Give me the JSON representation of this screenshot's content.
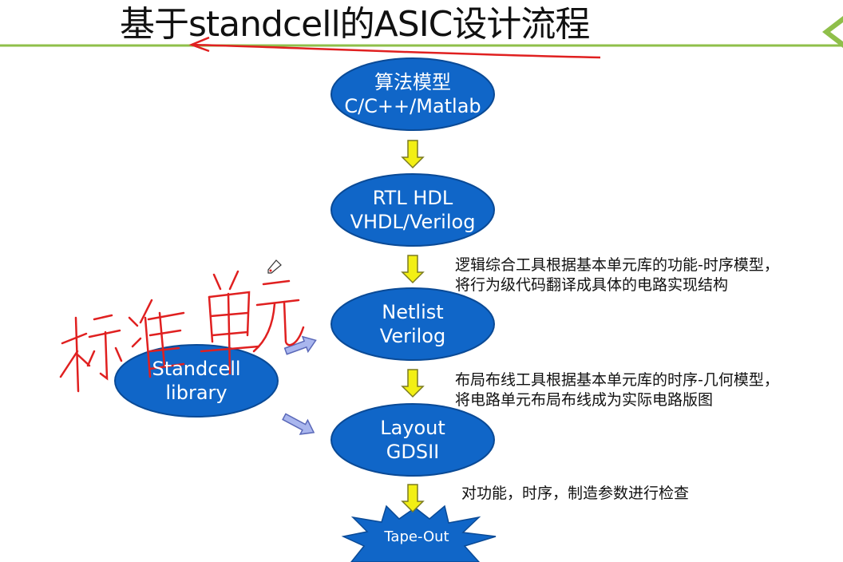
{
  "title": "基于standcell的ASIC设计流程",
  "colors": {
    "node_fill": "#1066c8",
    "node_stroke": "#0a4a96",
    "arrow_fill": "#f2ef14",
    "arrow_stroke": "#7a7a20",
    "side_arrow_fill": "#a9b6ee",
    "side_arrow_stroke": "#5a68b8",
    "header_line": "#8fbf4a",
    "annotation_red": "#e02020"
  },
  "flow": [
    {
      "line1": "算法模型",
      "line2": "C/C++/Matlab"
    },
    {
      "line1": "RTL HDL",
      "line2": "VHDL/Verilog"
    },
    {
      "line1": "Netlist",
      "line2": "Verilog"
    },
    {
      "line1": "Layout",
      "line2": "GDSII"
    }
  ],
  "tapeout": {
    "label": "Tape-Out"
  },
  "library": {
    "line1": "Standcell",
    "line2": "library"
  },
  "notes": {
    "synthesis": {
      "line1": "逻辑综合工具根据基本单元库的功能-时序模型，",
      "line2": "将行为级代码翻译成具体的电路实现结构"
    },
    "place_route": {
      "line1": "布局布线工具根据基本单元库的时序-几何模型，",
      "line2": "将电路单元布局布线成为实际电路版图"
    },
    "check": {
      "line1": "对功能，时序，制造参数进行检查"
    }
  }
}
